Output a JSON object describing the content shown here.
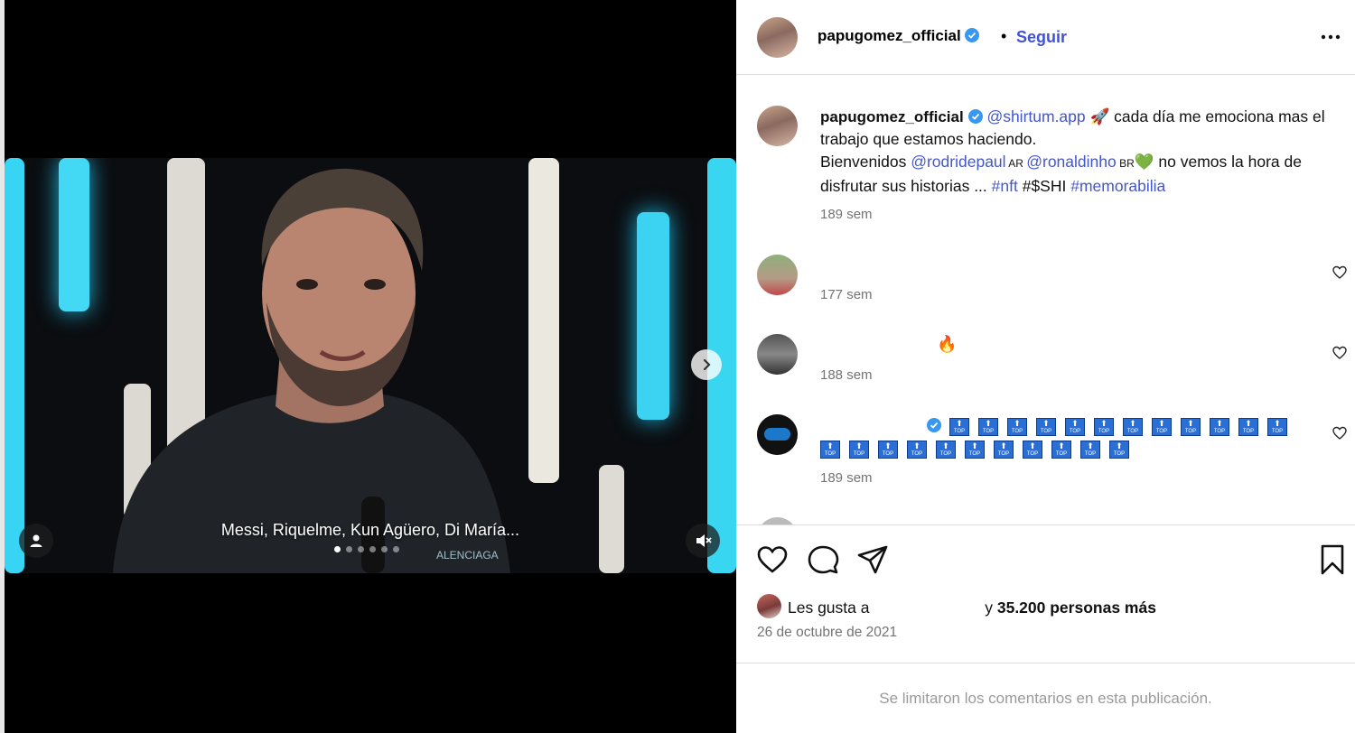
{
  "post": {
    "username": "papugomez_official",
    "follow_label": "Seguir",
    "separator": "•",
    "subtitle": "Messi, Riquelme, Kun Agüero, Di María...",
    "carousel_pages": 6,
    "carousel_active": 0
  },
  "caption": {
    "username": "papugomez_official",
    "mention1": "@shirtum.app",
    "emoji_rocket": "🚀",
    "text1": " cada día me emociona mas el trabajo que estamos haciendo.",
    "text2": "Bienvenidos ",
    "mention2": "@rodridepaul",
    "flag_ar": " AR ",
    "mention3": "@ronaldinho",
    "flag_br": " BR",
    "emoji_heart": "💚",
    "text3": " no vemos la hora de disfrutar sus historias ... ",
    "tag1": "#nft",
    "text4": " #$SHI ",
    "tag2": "#memorabilia",
    "time": "189 sem"
  },
  "comments": [
    {
      "time": "177 sem",
      "emoji": ""
    },
    {
      "time": "188 sem",
      "emoji": "🔥"
    },
    {
      "time": "189 sem",
      "emoji": "",
      "badge_label": "TOP",
      "badge_count": 23
    }
  ],
  "likes": {
    "prefix": "Les gusta a",
    "connector": "y",
    "count_text": "35.200 personas más"
  },
  "date": "26 de octubre de 2021",
  "comments_limited": "Se limitaron los comentarios en esta publicación.",
  "colors": {
    "link": "#4457c9",
    "follow": "#4152d6",
    "accent_cyan": "#39d6f2",
    "verified": "#3897f0",
    "badge_blue": "#2b6fd6"
  }
}
